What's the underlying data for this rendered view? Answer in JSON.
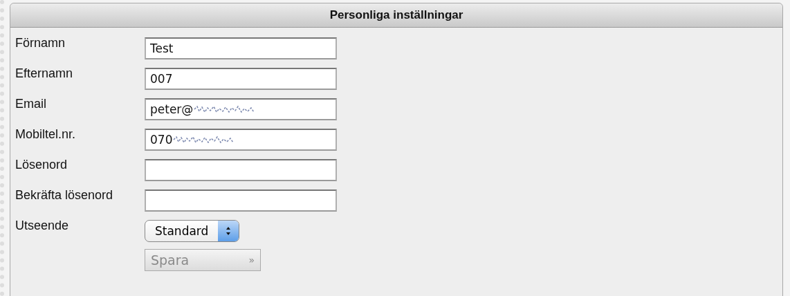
{
  "panel": {
    "title": "Personliga inställningar"
  },
  "fields": [
    {
      "label": "Förnamn",
      "value": "Test",
      "redacted": false
    },
    {
      "label": "Efternamn",
      "value": "007",
      "redacted": false
    },
    {
      "label": "Email",
      "value": "peter@",
      "redacted": true
    },
    {
      "label": "Mobiltel.nr.",
      "value": "070",
      "redacted": true
    },
    {
      "label": "Lösenord",
      "redacted": false
    },
    {
      "label": "Bekräfta lösenord",
      "redacted": false
    }
  ],
  "appearance": {
    "label": "Utseende",
    "value": "Standard"
  },
  "save_button": {
    "label": "Spara",
    "icon": "»",
    "disabled": true
  }
}
